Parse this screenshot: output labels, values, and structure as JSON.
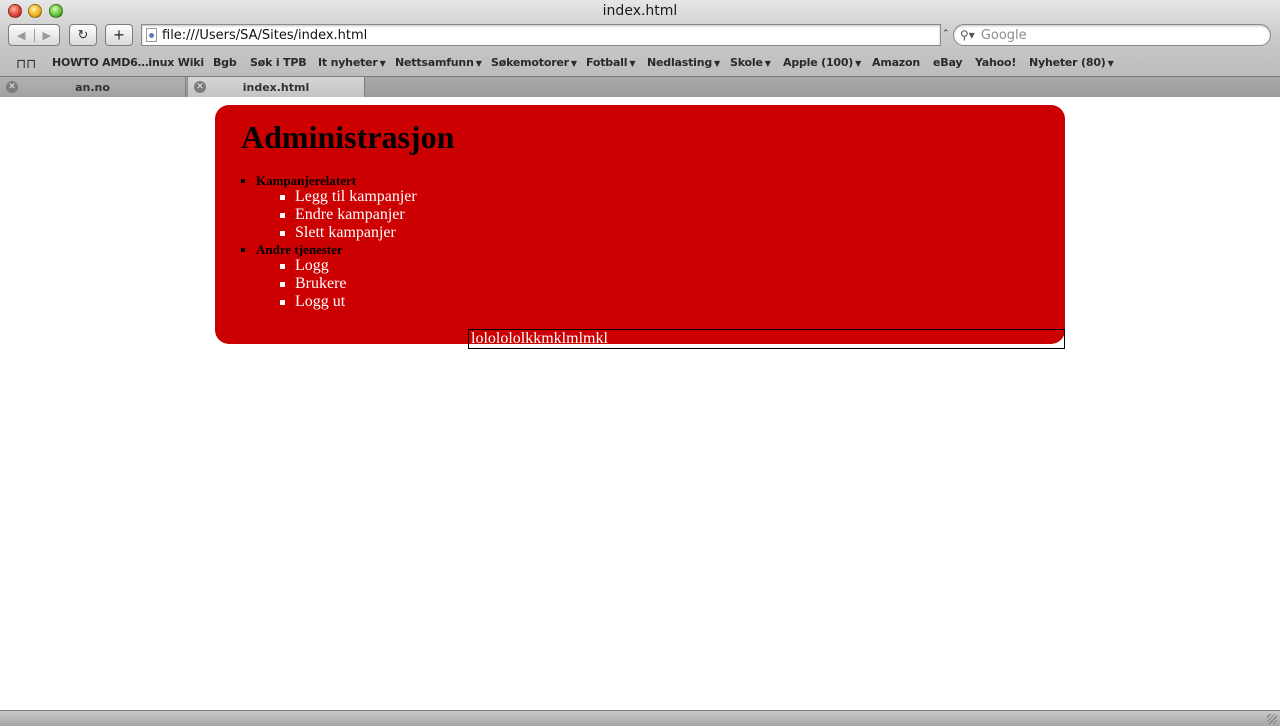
{
  "window": {
    "title": "index.html"
  },
  "toolbar": {
    "back_glyph": "◀",
    "forward_glyph": "▶",
    "reload_glyph": "↻",
    "add_glyph": "+",
    "address": "file:///Users/SA/Sites/index.html",
    "search_placeholder": "Google",
    "search_icon": "⚲▾"
  },
  "bookmarks": {
    "book_icon": "📖",
    "items": [
      {
        "label": "HOWTO AMD6…inux Wiki",
        "arrow": ""
      },
      {
        "label": "Bgb",
        "arrow": ""
      },
      {
        "label": "Søk i TPB",
        "arrow": ""
      },
      {
        "label": "It nyheter",
        "arrow": "▼"
      },
      {
        "label": "Nettsamfunn",
        "arrow": "▼"
      },
      {
        "label": "Søkemotorer",
        "arrow": "▼"
      },
      {
        "label": "Fotball",
        "arrow": "▼"
      },
      {
        "label": "Nedlasting",
        "arrow": "▼"
      },
      {
        "label": "Skole",
        "arrow": "▼"
      },
      {
        "label": "Apple (100)",
        "arrow": "▼"
      },
      {
        "label": "Amazon",
        "arrow": ""
      },
      {
        "label": "eBay",
        "arrow": ""
      },
      {
        "label": "Yahoo!",
        "arrow": ""
      },
      {
        "label": "Nyheter (80)",
        "arrow": "▼"
      }
    ]
  },
  "tabs": [
    {
      "label": "an.no",
      "close": "✕"
    },
    {
      "label": "index.html",
      "close": "✕"
    }
  ],
  "page": {
    "title": "Administrasjon",
    "sections": [
      {
        "label": "Kampanjerelatert",
        "items": [
          "Legg til kampanjer",
          "Endre kampanjer",
          "Slett kampanjer"
        ]
      },
      {
        "label": "Andre tjenester",
        "items": [
          "Logg",
          "Brukere",
          "Logg ut"
        ]
      }
    ],
    "footer_text": "lololololkkmklmlmkl"
  },
  "colors": {
    "admin_bg": "#cc0000",
    "menu_link": "#ffffff"
  }
}
